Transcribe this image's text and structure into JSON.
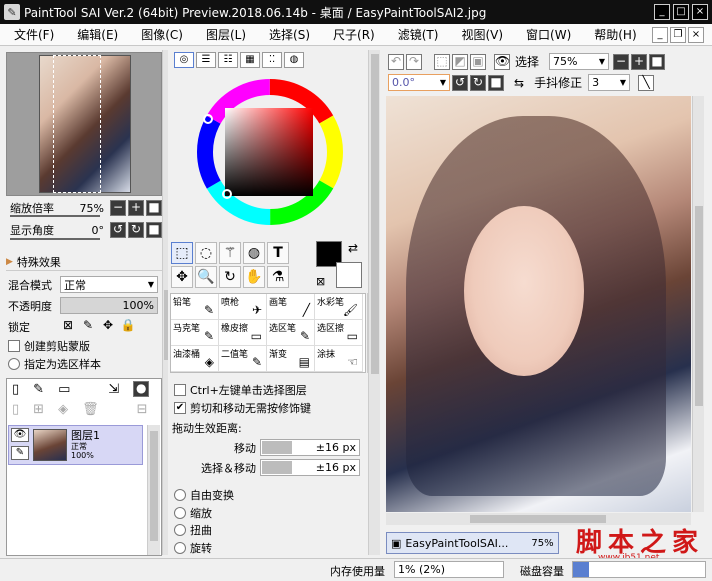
{
  "window": {
    "title": "PaintTool SAI Ver.2 (64bit) Preview.2018.06.14b - 桌面 / EasyPaintToolSAI2.jpg",
    "controls": [
      "_",
      "□",
      "×"
    ],
    "mdi_controls": [
      "_",
      "❐",
      "×"
    ]
  },
  "menu": [
    "文件(F)",
    "编辑(E)",
    "图像(C)",
    "图层(L)",
    "选择(S)",
    "尺子(R)",
    "滤镜(T)",
    "视图(V)",
    "窗口(W)",
    "帮助(H)"
  ],
  "navigator": {
    "zoom_label": "缩放倍率",
    "zoom_value": "75%",
    "angle_label": "显示角度",
    "angle_value": "0°"
  },
  "effects": {
    "header": "特殊效果"
  },
  "layer_props": {
    "blend_label": "混合模式",
    "blend_value": "正常",
    "opacity_label": "不透明度",
    "opacity_value": "100%",
    "lock_label": "锁定",
    "clip_label": "创建剪贴蒙版",
    "sample_label": "指定为选区样本"
  },
  "layer": {
    "name": "图层1",
    "mode": "正常",
    "opacity": "100%"
  },
  "color": {
    "primary": "#000000",
    "secondary": "#ffffff"
  },
  "brushes": [
    {
      "label": "铅笔",
      "icon": "✎"
    },
    {
      "label": "喷枪",
      "icon": "✈"
    },
    {
      "label": "画笔",
      "icon": "╱"
    },
    {
      "label": "水彩笔",
      "icon": "🖌"
    },
    {
      "label": "马克笔",
      "icon": "✎"
    },
    {
      "label": "橡皮擦",
      "icon": "▭"
    },
    {
      "label": "选区笔",
      "icon": "✎"
    },
    {
      "label": "选区擦",
      "icon": "▭"
    },
    {
      "label": "油漆桶",
      "icon": "◈"
    },
    {
      "label": "二值笔",
      "icon": "✎"
    },
    {
      "label": "渐变",
      "icon": "▤"
    },
    {
      "label": "涂抹",
      "icon": "☜"
    }
  ],
  "tool_options": {
    "ctrl_label": "Ctrl+左键单击选择图层",
    "cut_label": "剪切和移动无需按修饰键",
    "drag_label": "拖动生效距离:",
    "move_label": "移动",
    "move_value": "±16 px",
    "select_move_label": "选择＆移动",
    "select_move_value": "±16 px",
    "transform_options": [
      "自由变换",
      "缩放",
      "扭曲",
      "旋转"
    ]
  },
  "canvas_toolbar": {
    "select_label": "选择",
    "zoom_value": "75%",
    "angle_value": "0.0°",
    "stabilizer_label": "手抖修正",
    "stabilizer_value": "3"
  },
  "task": {
    "name": "EasyPaintToolSAI...",
    "zoom": "75%"
  },
  "status": {
    "memory_label": "内存使用量",
    "memory_value": "1% (2%)",
    "disk_label": "磁盘容量"
  },
  "watermark": {
    "text": "脚本之家",
    "url": "www.jb51.net"
  }
}
